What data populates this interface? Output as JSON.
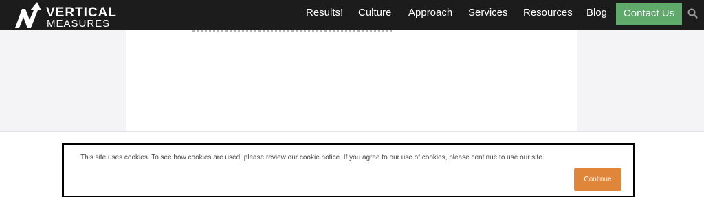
{
  "header": {
    "logo": {
      "line1": "VERTICAL",
      "line2": "MEASURES"
    },
    "nav": [
      {
        "label": "Results!"
      },
      {
        "label": "Culture"
      },
      {
        "label": "Approach"
      },
      {
        "label": "Services"
      },
      {
        "label": "Resources"
      },
      {
        "label": "Blog"
      }
    ],
    "contact_label": "Contact Us",
    "search_icon": "search-icon"
  },
  "cookie": {
    "message": "This site uses cookies. To see how cookies are used, please review our cookie notice. If you agree to our use of cookies, please continue to use our site.",
    "continue_label": "Continue"
  },
  "colors": {
    "header_bg": "#1c1c1c",
    "contact_bg": "#5faa6b",
    "continue_bg": "#e0863a",
    "page_bg": "#f4f4f6"
  }
}
